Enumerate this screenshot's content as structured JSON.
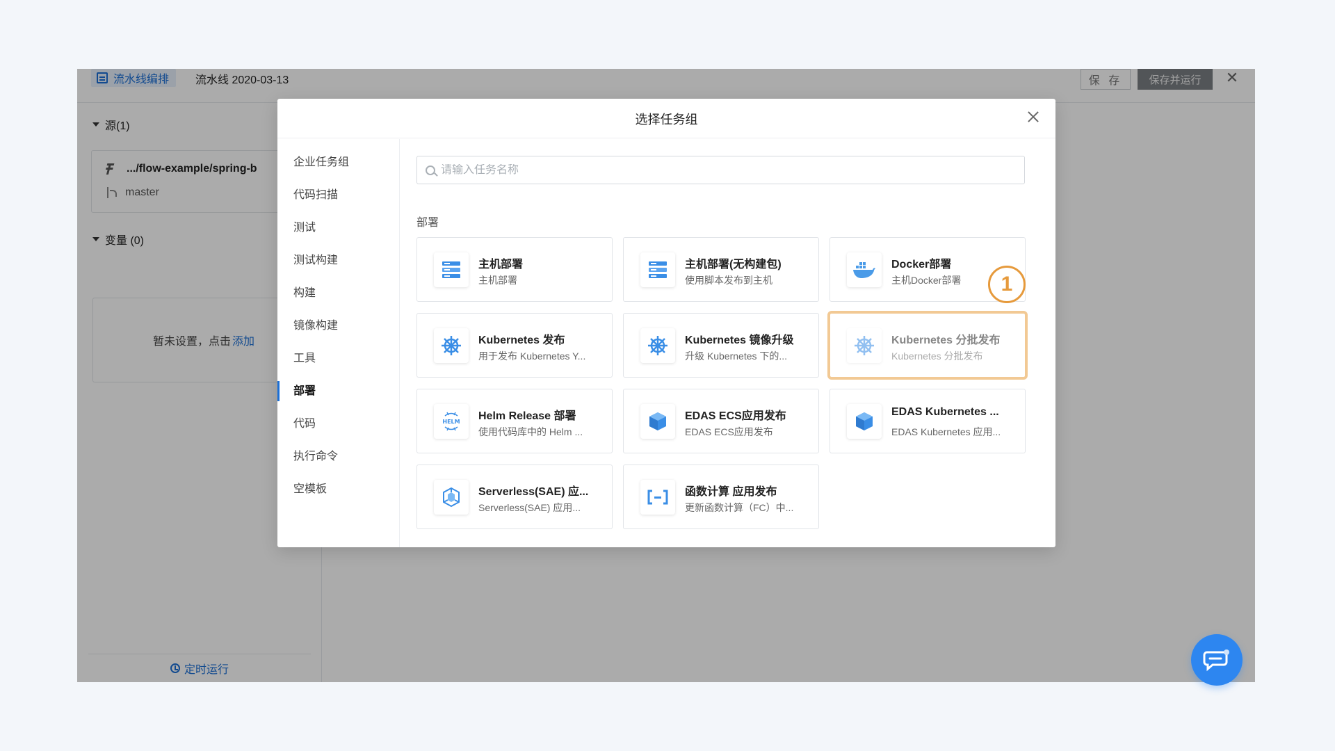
{
  "app": {
    "brand_label": "流水线编排",
    "pipeline_name": "流水线 2020-03-13",
    "save_label": "保 存",
    "save_run_label": "保存并运行",
    "close_glyph": "✕"
  },
  "left_panel": {
    "source_header": "源(1)",
    "source_repo": ".../flow-example/spring-b",
    "source_branch": "master",
    "variables_header": "变量 (0)",
    "variables_empty_text": "暂未设置，点击",
    "variables_add_link": "添加",
    "footer_label": "定时运行"
  },
  "modal": {
    "title": "选择任务组",
    "search_placeholder": "请输入任务名称",
    "group_title": "部署",
    "nav": [
      {
        "label": "企业任务组"
      },
      {
        "label": "代码扫描"
      },
      {
        "label": "测试"
      },
      {
        "label": "测试构建"
      },
      {
        "label": "构建"
      },
      {
        "label": "镜像构建"
      },
      {
        "label": "工具"
      },
      {
        "label": "部署"
      },
      {
        "label": "代码"
      },
      {
        "label": "执行命令"
      },
      {
        "label": "空模板"
      }
    ],
    "active_nav": "部署",
    "cards": [
      {
        "title": "主机部署",
        "desc": "主机部署",
        "icon": "server-icon"
      },
      {
        "title": "主机部署(无构建包)",
        "desc": "使用脚本发布到主机",
        "icon": "server-icon"
      },
      {
        "title": "Docker部署",
        "desc": "主机Docker部署",
        "icon": "docker-icon"
      },
      {
        "title": "Kubernetes 发布",
        "desc": "用于发布 Kubernetes Y...",
        "icon": "kubernetes-icon"
      },
      {
        "title": "Kubernetes 镜像升级",
        "desc": "升级 Kubernetes 下的...",
        "icon": "kubernetes-icon"
      },
      {
        "title": "Kubernetes 分批发布",
        "desc": "Kubernetes 分批发布",
        "icon": "kubernetes-icon"
      },
      {
        "title": "Helm Release 部署",
        "desc": "使用代码库中的 Helm ...",
        "icon": "helm-icon"
      },
      {
        "title": "EDAS ECS应用发布",
        "desc": "EDAS ECS应用发布",
        "icon": "edas-cube-icon"
      },
      {
        "title": "EDAS Kubernetes ...",
        "desc": "EDAS Kubernetes 应用...",
        "icon": "edas-cube-icon"
      },
      {
        "title": "Serverless(SAE) 应...",
        "desc": "Serverless(SAE) 应用...",
        "icon": "sae-icon"
      },
      {
        "title": "函数计算 应用发布",
        "desc": "更新函数计算（FC）中...",
        "icon": "function-compute-icon"
      }
    ]
  },
  "annotation": {
    "step_number": "1"
  },
  "colors": {
    "accent": "#1b6fd6",
    "highlight_border": "#f2c994",
    "step_badge": "#e69a3c",
    "chat_button": "#2d86f0"
  }
}
